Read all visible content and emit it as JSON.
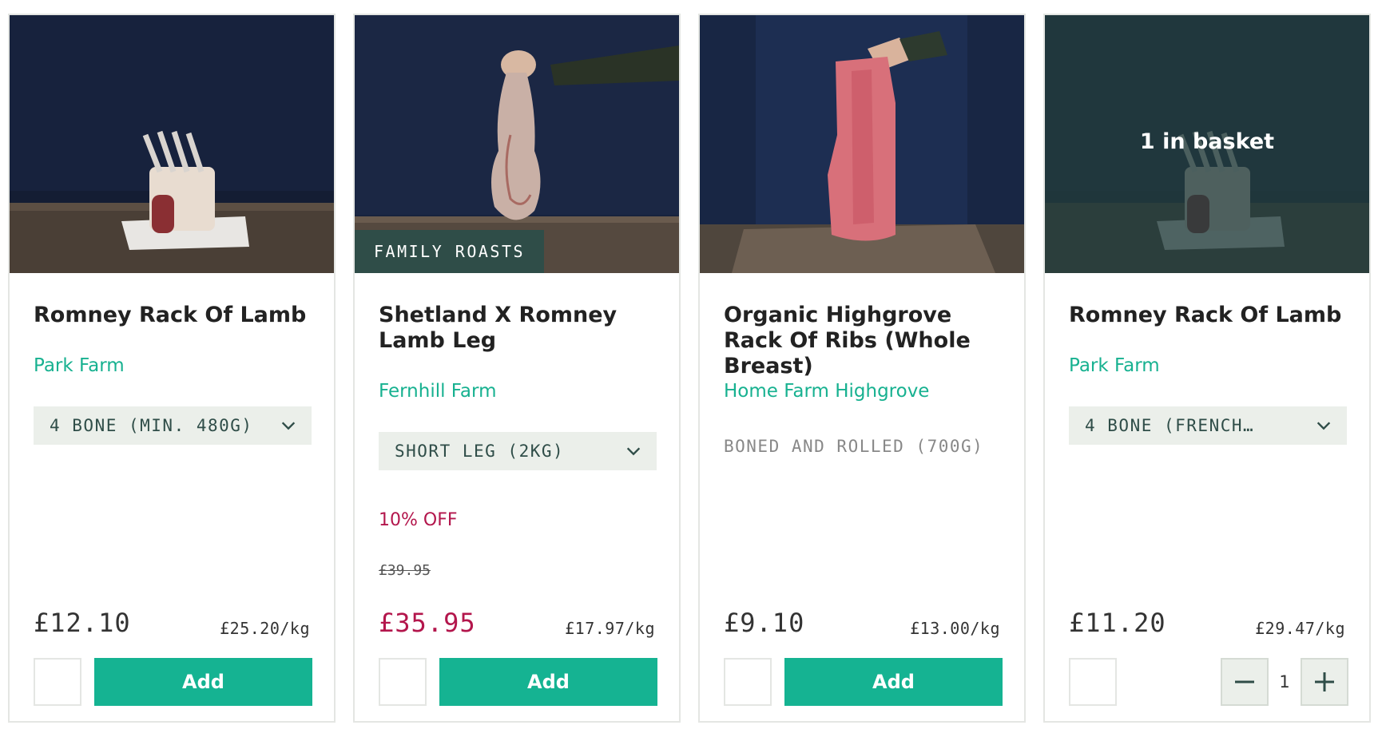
{
  "products": [
    {
      "title": "Romney Rack Of Lamb",
      "farm": "Park Farm",
      "variant": "4 BONE (MIN. 480G)",
      "price": "£12.10",
      "unit_price": "£25.20/kg",
      "add_label": "Add"
    },
    {
      "tag": "FAMILY ROASTS",
      "title": "Shetland X Romney Lamb Leg",
      "farm": "Fernhill Farm",
      "variant": "SHORT LEG (2KG)",
      "discount": "10% OFF",
      "old_price": "£39.95",
      "price": "£35.95",
      "unit_price": "£17.97/kg",
      "add_label": "Add"
    },
    {
      "title": "Organic Highgrove Rack Of Ribs (Whole Breast)",
      "farm": "Home Farm Highgrove",
      "variant": "BONED AND ROLLED (700G)",
      "price": "£9.10",
      "unit_price": "£13.00/kg",
      "add_label": "Add"
    },
    {
      "basket_status": "1 in basket",
      "title": "Romney Rack Of Lamb",
      "farm": "Park Farm",
      "variant": "4 BONE (FRENCH…",
      "price": "£11.20",
      "unit_price": "£29.47/kg",
      "quantity": "1"
    }
  ],
  "colors": {
    "accent": "#15b392",
    "sale": "#b3164c",
    "tag_bg": "#2f4d48",
    "select_bg": "#ebefea"
  },
  "icons": {
    "select_toggle": "chevron-down-icon",
    "decrease": "minus-icon",
    "increase": "plus-icon"
  }
}
